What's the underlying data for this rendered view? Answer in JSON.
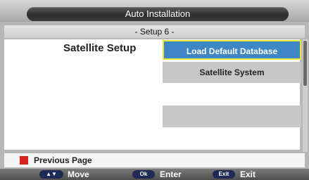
{
  "header": {
    "title": "Auto Installation",
    "step": "- Setup 6 -"
  },
  "main": {
    "heading": "Satellite Setup",
    "options": [
      {
        "label": "Load Default Database",
        "selected": true
      },
      {
        "label": "Satellite System",
        "selected": false
      },
      {
        "label": "",
        "selected": false
      }
    ]
  },
  "bottom": {
    "previous_page": "Previous Page",
    "color_key": "#d8221c"
  },
  "footer": {
    "move_key": "▲▼",
    "move_label": "Move",
    "ok_key": "Ok",
    "enter_label": "Enter",
    "exit_key": "Exit",
    "exit_label": "Exit"
  },
  "colors": {
    "selected_bg": "#3f86c4",
    "selected_border": "#e6e33a",
    "option_bg": "#c7c7c7",
    "title_pill": "#333333"
  }
}
